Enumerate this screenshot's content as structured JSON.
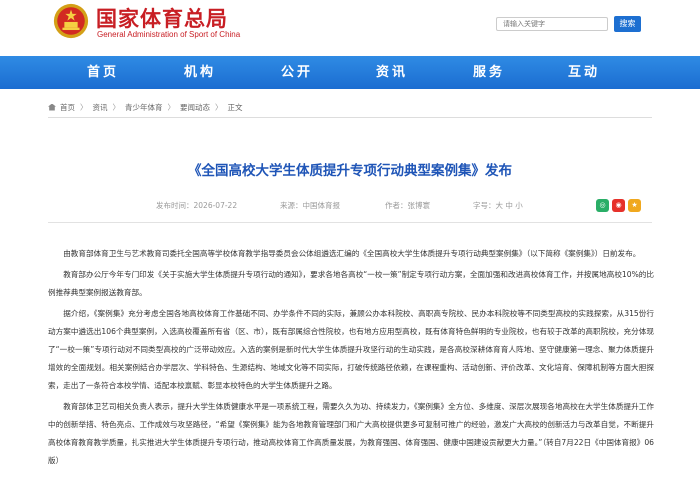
{
  "header": {
    "site_name": "国家体育总局",
    "site_name_en": "General Administration of Sport of China",
    "search_placeholder": "请输入关键字",
    "search_button": "搜索",
    "colors": {
      "brand_red": "#c81e24",
      "nav_blue": "#1b6dd1",
      "title_blue": "#1f55b7"
    }
  },
  "nav": {
    "items": [
      {
        "label": "首页"
      },
      {
        "label": "机构"
      },
      {
        "label": "公开"
      },
      {
        "label": "资讯"
      },
      {
        "label": "服务"
      },
      {
        "label": "互动"
      }
    ]
  },
  "breadcrumb": {
    "items": [
      "首页",
      "资讯",
      "青少年体育",
      "要闻动态",
      "正文"
    ]
  },
  "article": {
    "title": "《全国高校大学生体质提升专项行动典型案例集》发布",
    "meta": {
      "time": "发布时间：2026-07-22",
      "source": "来源：中国体育报",
      "author": "作者：张博寰",
      "font_size": "字号：大 中 小"
    },
    "share_icons": [
      "wechat-icon",
      "weibo-icon",
      "favorite-icon"
    ],
    "paragraphs": [
      "由教育部体育卫生与艺术教育司委托全国高等学校体育教学指导委员会公体组遴选汇编的《全国高校大学生体质提升专项行动典型案例集》（以下简称《案例集》）日前发布。",
      "教育部办公厅今年专门印发《关于实施大学生体质提升专项行动的通知》，要求各地各高校“一校一策”制定专项行动方案，全面加强和改进高校体育工作，并按属地高校10%的比例推荐典型案例报送教育部。",
      "据介绍，《案例集》充分考虑全国各地高校体育工作基础不同、办学条件不同的实际，兼顾公办本科院校、高职高专院校、民办本科院校等不同类型高校的实践探索，从315份行动方案中遴选出106个典型案例，入选高校覆盖所有省（区、市），既有部属综合性院校，也有地方应用型高校，既有体育特色鲜明的专业院校，也有较于改革的高职院校，充分体现了“一校一策”专项行动对不同类型高校的广泛带动效应。入选的案例是新时代大学生体质提升攻坚行动的生动实践，是各高校深耕体育育人阵地、坚守健康第一理念、聚力体质提升增效的全面规划。相关案例结合办学层次、学科特色、生源结构、地域文化等不同实际，打破传统路径依赖，在课程重构、活动创新、评价改革、文化培育、保障机制等方面大胆探索，走出了一条符合本校学情、适配本校禀赋、彰显本校特色的大学生体质提升之路。",
      "教育部体卫艺司相关负责人表示，提升大学生体质健康水平是一项系统工程，需要久久为功、持续发力，《案例集》全方位、多维度、深层次展现各地高校在大学生体质提升工作中的创新举措、特色亮点、工作成效与攻坚路径，“希望《案例集》能为各地教育管理部门和广大高校提供更多可复制可推广的经验，激发广大高校的创新活力与改革自觉，不断提升高校体育教育教学质量，扎实推进大学生体质提升专项行动，推动高校体育工作高质量发展，为教育强国、体育强国、健康中国建设贡献更大力量。”（转自7月22日《中国体育报》06版）"
    ]
  }
}
